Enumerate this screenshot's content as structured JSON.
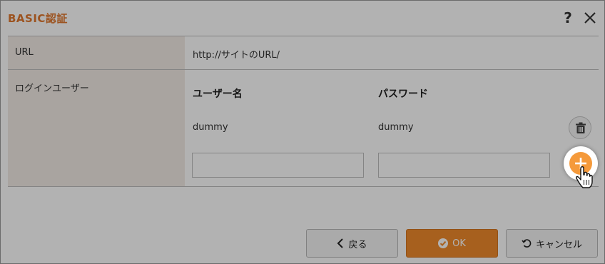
{
  "dialog": {
    "title": "BASIC認証",
    "help_glyph": "?"
  },
  "form": {
    "url_label": "URL",
    "url_value": "http://サイトのURL/",
    "login_label": "ログインユーザー",
    "columns": {
      "username": "ユーザー名",
      "password": "パスワード"
    },
    "users": [
      {
        "username": "dummy",
        "password": "dummy"
      }
    ],
    "new_user": {
      "username": "",
      "password": ""
    }
  },
  "buttons": {
    "back": "戻る",
    "ok": "OK",
    "cancel": "キャンセル"
  },
  "colors": {
    "accent": "#f08a2c",
    "title": "#e0782e",
    "label_bg": "#f2ebe5"
  },
  "icons": [
    "help-icon",
    "close-icon",
    "trash-icon",
    "plus-icon",
    "chevron-left-icon",
    "check-circle-icon",
    "undo-icon",
    "hand-cursor-icon"
  ]
}
